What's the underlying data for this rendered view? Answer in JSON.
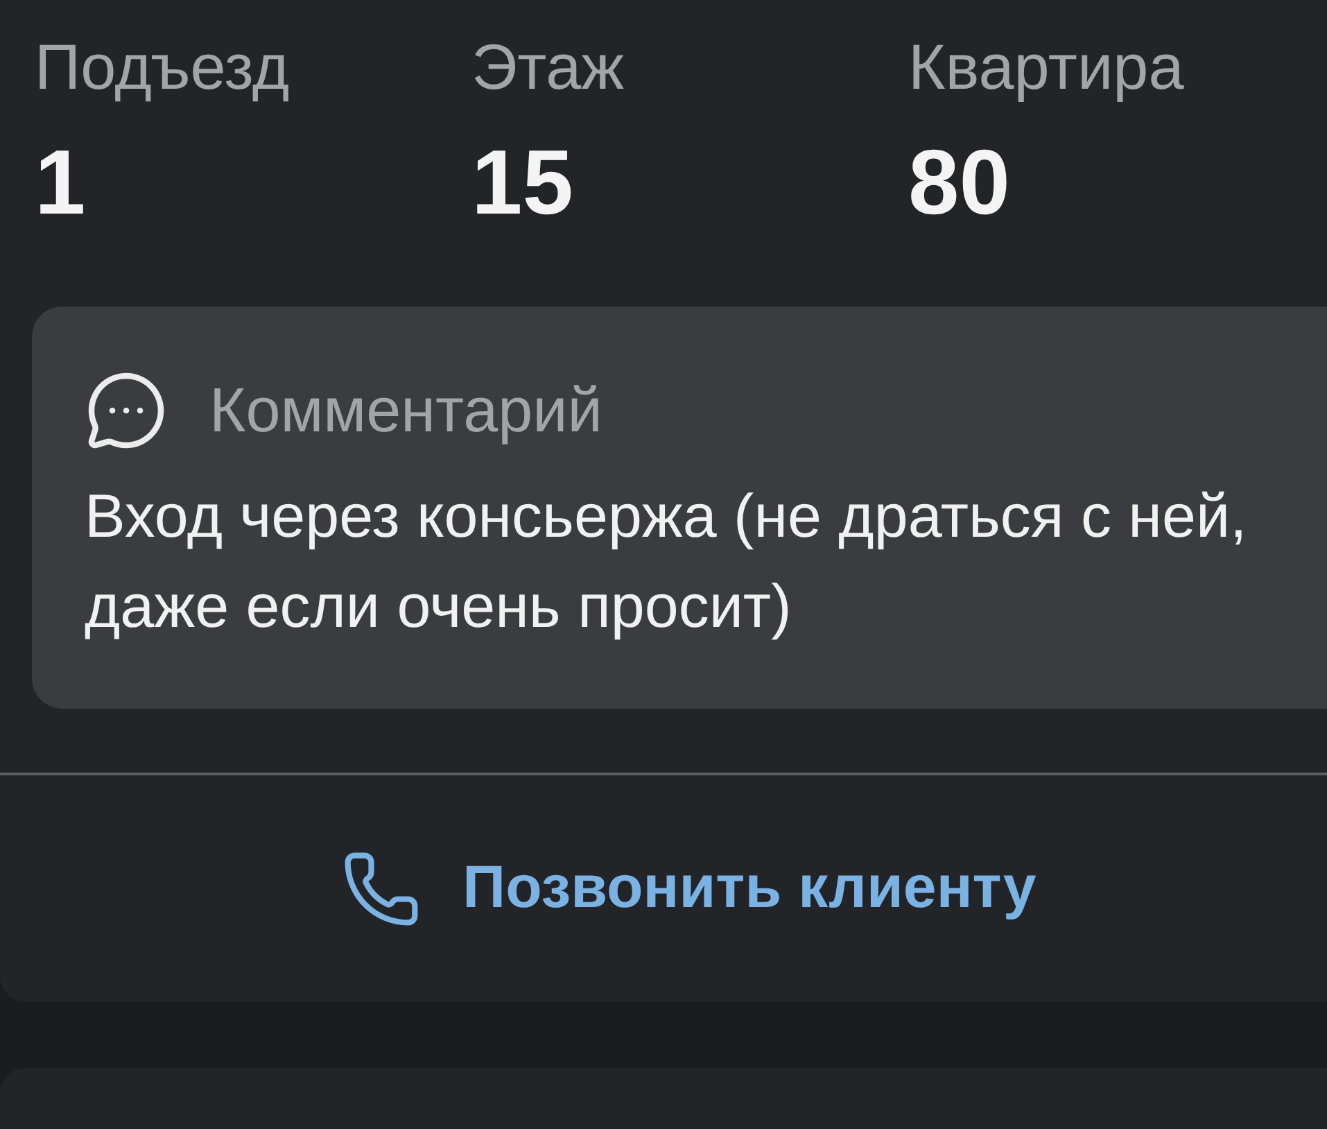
{
  "address_fields": [
    {
      "label": "Подъезд",
      "value": "1"
    },
    {
      "label": "Этаж",
      "value": "15"
    },
    {
      "label": "Квартира",
      "value": "80"
    }
  ],
  "comment": {
    "title": "Комментарий",
    "text": "Вход через консьержа (не драться с ней, даже если очень просит)"
  },
  "call_button": {
    "label": "Позвонить клиенту"
  }
}
